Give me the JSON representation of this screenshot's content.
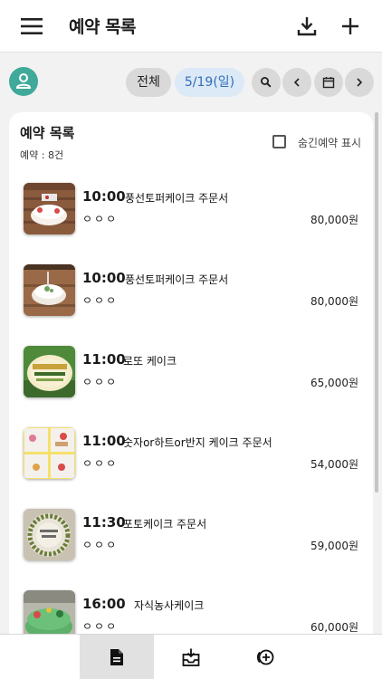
{
  "appbar": {
    "title": "예약 목록",
    "icons": [
      "menu-icon",
      "download-icon",
      "plus-icon"
    ]
  },
  "filters": {
    "all_label": "전체",
    "date_label": "5/19(일)",
    "icons": [
      "search-icon",
      "chevron-left-icon",
      "calendar-icon",
      "chevron-right-icon"
    ]
  },
  "card": {
    "title": "예약 목록",
    "count_label": "예약 : 8건",
    "hidden_label": "숨긴예약 표시",
    "hidden_checked": false
  },
  "reservations": [
    {
      "time": "10:00",
      "name": "풍선토퍼케이크 주문서",
      "customer": "ㅇㅇㅇ",
      "price": "80,000원"
    },
    {
      "time": "10:00",
      "name": "풍선토퍼케이크 주문서",
      "customer": "ㅇㅇㅇ",
      "price": "80,000원"
    },
    {
      "time": "11:00",
      "name": "로또 케이크",
      "customer": "ㅇㅇㅇ",
      "price": "65,000원"
    },
    {
      "time": "11:00",
      "name": "숫자or하트or반지 케이크 주문서",
      "customer": "ㅇㅇㅇ",
      "price": "54,000원"
    },
    {
      "time": "11:30",
      "name": "포토케이크 주문서",
      "customer": "ㅇㅇㅇ",
      "price": "59,000원"
    },
    {
      "time": "16:00",
      "name": "자식농사케이크",
      "customer": "ㅇㅇㅇ",
      "price": "60,000원"
    }
  ],
  "bottom_nav": {
    "items": [
      "document-icon",
      "inbox-icon",
      "add-circle-icon"
    ],
    "active": "document-icon"
  },
  "colors": {
    "accent": "#2f6fb7",
    "avatar": "#3fa99a",
    "pill": "#d9d9d9"
  }
}
